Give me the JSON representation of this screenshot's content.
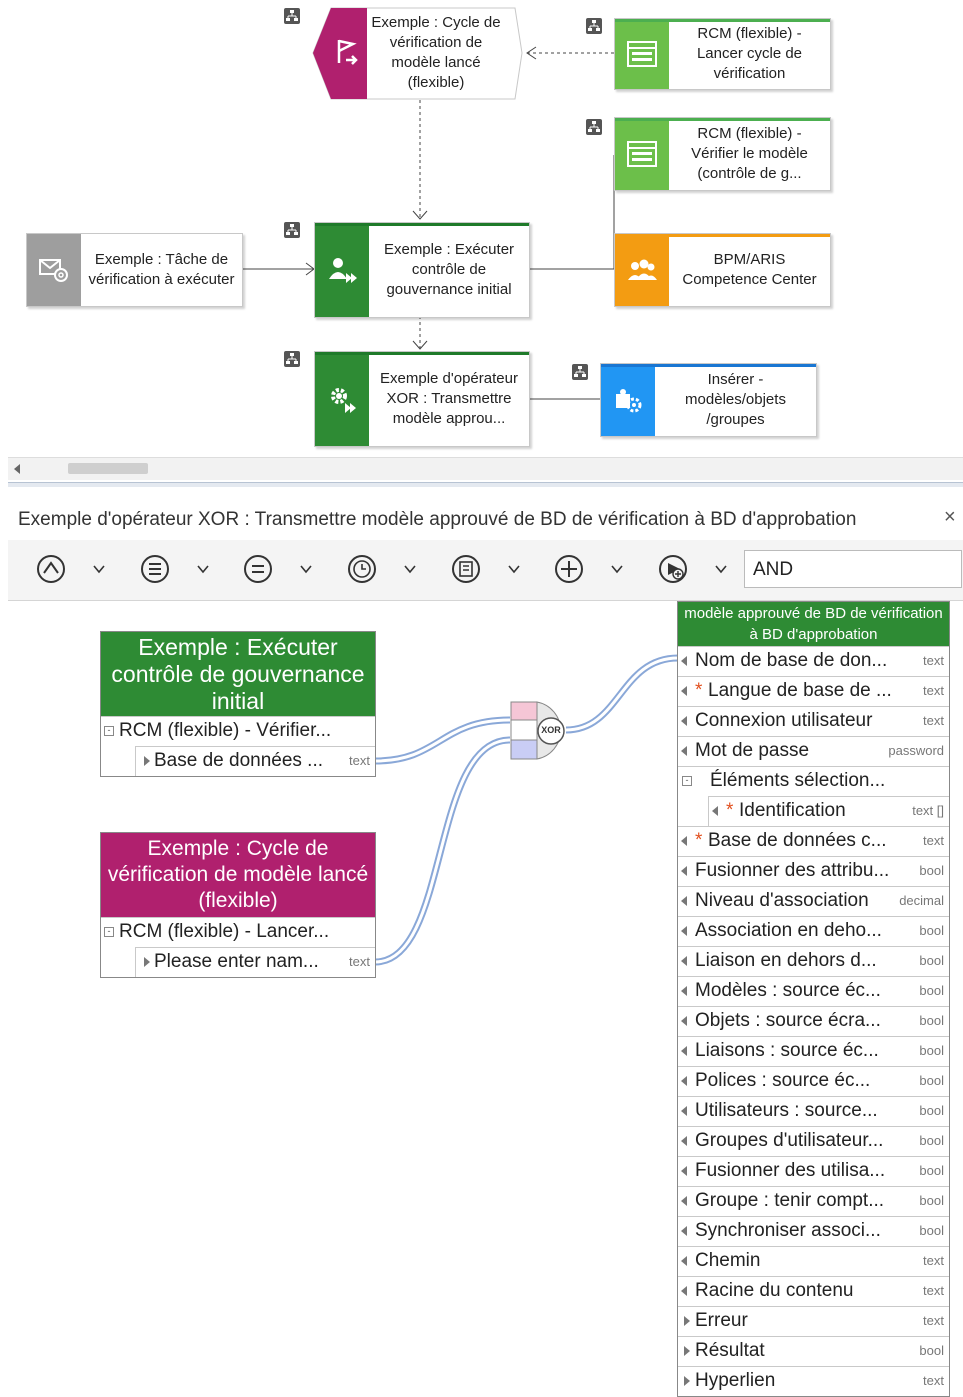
{
  "model": {
    "event_start": "Exemple : Cycle de vérification de modèle lancé (flexible)",
    "launch_screen": "RCM (flexible) - Lancer cycle de vérification",
    "verify_screen": "RCM (flexible) - Vérifier le modèle (contrôle de g...",
    "competence": "BPM/ARIS Competence Center",
    "task_event": "Exemple : Tâche de vérification à exécuter",
    "execute_func": "Exemple : Exécuter contrôle de gouvernance initial",
    "xor_func": "Exemple d'opérateur XOR : Transmettre modèle approu...",
    "insert_service": "Insérer - modèles/objets /groupes"
  },
  "panel": {
    "title": "Exemple d'opérateur XOR : Transmettre modèle approuvé de BD de vérification à BD d'approbation",
    "operator_value": "AND",
    "xor_label": "XOR",
    "source1": {
      "title": "Exemple : Exécuter contrôle de gouvernance initial",
      "item": "RCM (flexible) - Vérifier...",
      "sub": "Base de données ...",
      "sub_type": "text"
    },
    "source2": {
      "title": "Exemple : Cycle de vérification de modèle lancé (flexible)",
      "item": "RCM (flexible) - Lancer...",
      "sub": "Please enter nam...",
      "sub_type": "text"
    },
    "target": {
      "title": "modèle approuvé de BD de vérification à BD d'approbation",
      "rows": [
        {
          "label": "Nom de base de don...",
          "type": "text"
        },
        {
          "label": "Langue de base de ...",
          "type": "text",
          "required": "*"
        },
        {
          "label": "Connexion utilisateur",
          "type": "text"
        },
        {
          "label": "Mot de passe",
          "type": "password"
        },
        {
          "label": "Éléments sélection...",
          "type": ""
        },
        {
          "label": "Identification",
          "type": "text []",
          "required": "*"
        },
        {
          "label": "Base de données c...",
          "type": "text",
          "required": "*"
        },
        {
          "label": "Fusionner des attribu...",
          "type": "bool"
        },
        {
          "label": "Niveau d'association",
          "type": "decimal"
        },
        {
          "label": "Association en deho...",
          "type": "bool"
        },
        {
          "label": "Liaison en dehors d...",
          "type": "bool"
        },
        {
          "label": "Modèles : source éc...",
          "type": "bool"
        },
        {
          "label": "Objets : source écra...",
          "type": "bool"
        },
        {
          "label": "Liaisons : source éc...",
          "type": "bool"
        },
        {
          "label": "Polices : source éc...",
          "type": "bool"
        },
        {
          "label": "Utilisateurs : source...",
          "type": "bool"
        },
        {
          "label": "Groupes d'utilisateur...",
          "type": "bool"
        },
        {
          "label": "Fusionner des utilisa...",
          "type": "bool"
        },
        {
          "label": "Groupe : tenir compt...",
          "type": "bool"
        },
        {
          "label": "Synchroniser associ...",
          "type": "bool"
        },
        {
          "label": "Chemin",
          "type": "text"
        },
        {
          "label": "Racine du contenu",
          "type": "text"
        },
        {
          "label": "Erreur",
          "type": "text"
        },
        {
          "label": "Résultat",
          "type": "bool"
        },
        {
          "label": "Hyperlien",
          "type": "text"
        }
      ]
    }
  },
  "colors": {
    "magenta": "#b0206e",
    "green": "#2e8b34",
    "light_green": "#6cbf4a",
    "orange": "#f39c12",
    "blue": "#2196f3",
    "grey": "#9e9e9e"
  }
}
